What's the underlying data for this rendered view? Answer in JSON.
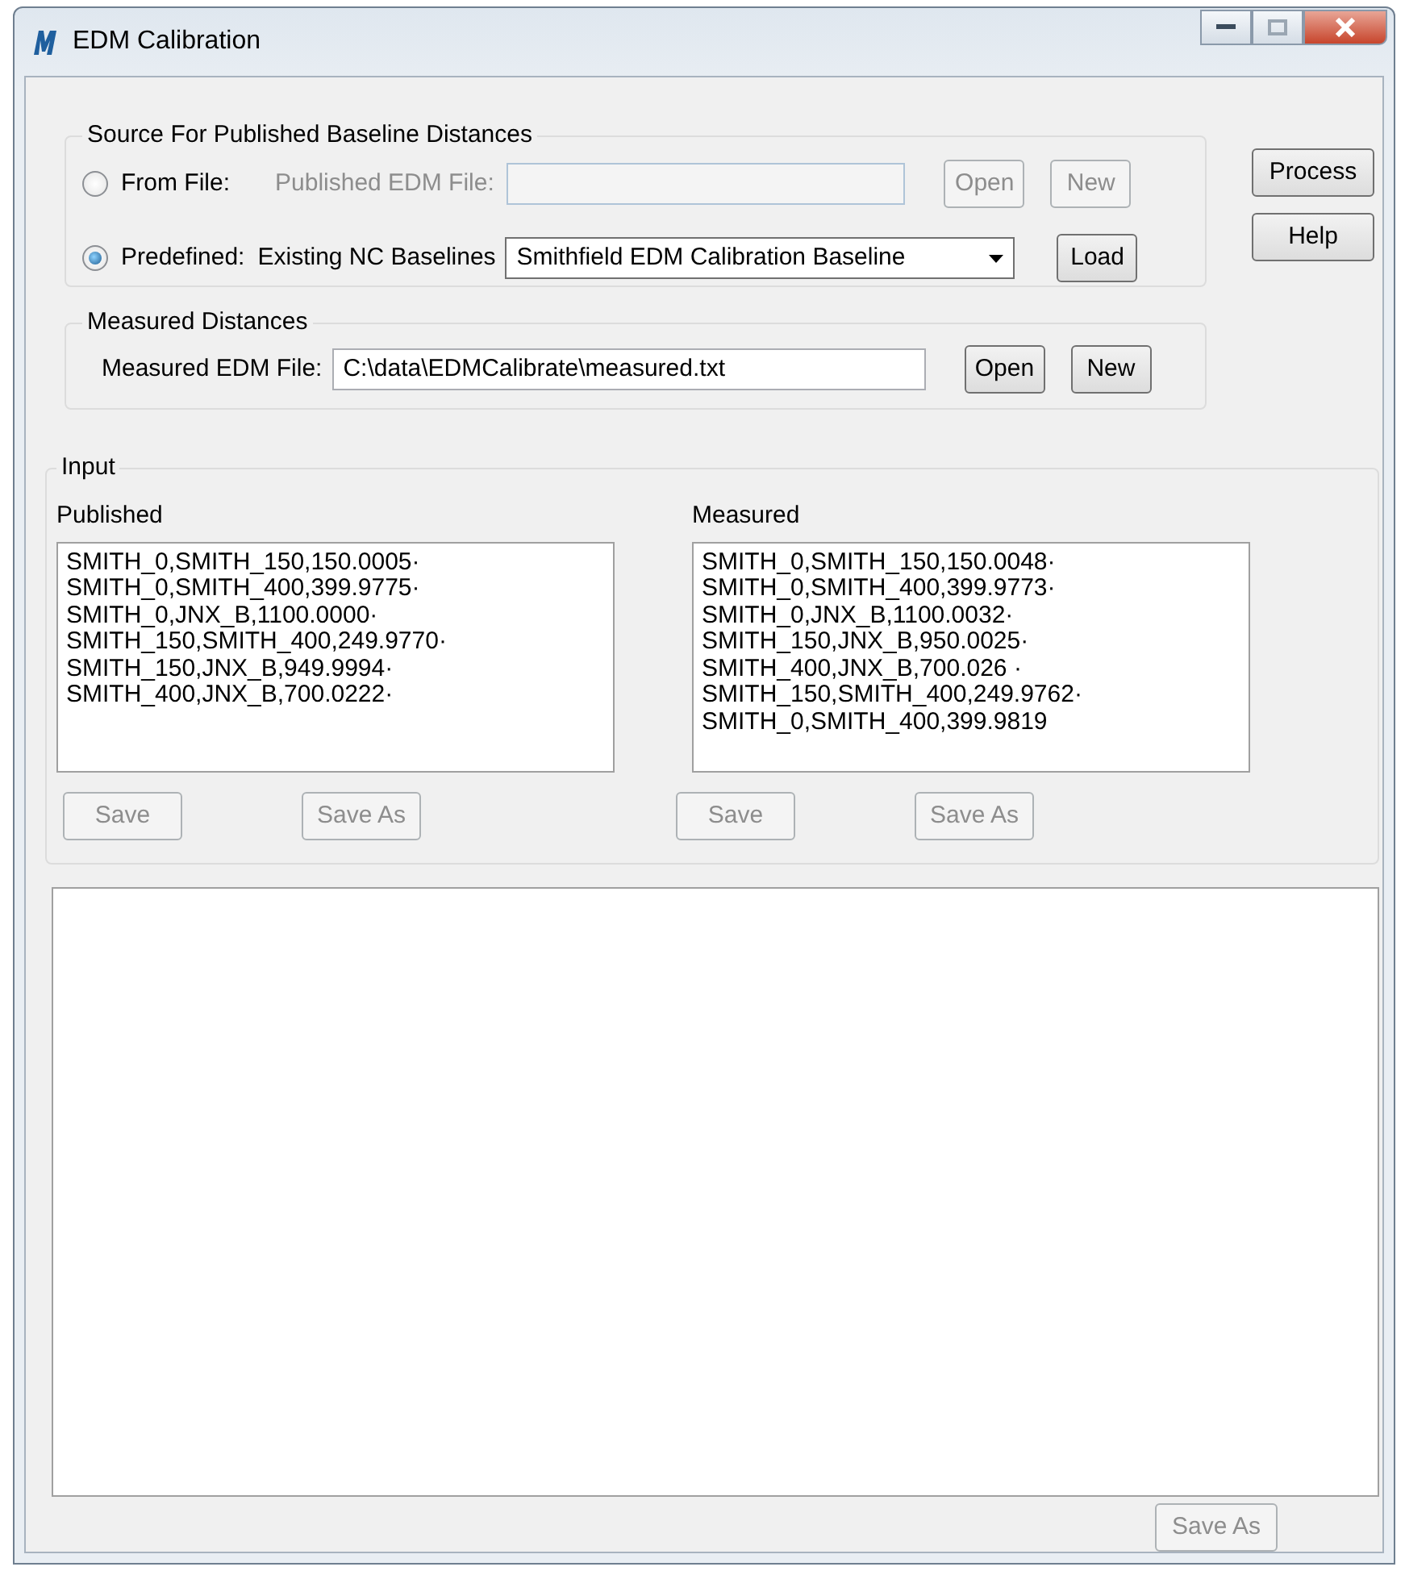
{
  "window": {
    "title": "EDM Calibration"
  },
  "source": {
    "legend": "Source For Published Baseline Distances",
    "from_file": {
      "label": "From File:",
      "selected": false,
      "field_label": "Published EDM File:",
      "disabled": true,
      "buttons": [
        {
          "label": "Open",
          "disabled": true
        },
        {
          "label": "New",
          "disabled": true
        }
      ]
    },
    "predefined": {
      "label": "Predefined:",
      "selected": true,
      "field_label": "Existing NC Baselines",
      "value": "Smithfield EDM Calibration Baseline",
      "buttons": [
        {
          "label": "Load",
          "disabled": false
        }
      ]
    }
  },
  "side_buttons": [
    {
      "label": "Process",
      "disabled": false
    },
    {
      "label": "Help",
      "disabled": false
    }
  ],
  "measured": {
    "legend": "Measured Distances",
    "field_label": "Measured EDM File:",
    "value": "C:\\data\\EDMCalibrate\\measured.txt",
    "buttons": [
      {
        "label": "Open",
        "disabled": false
      },
      {
        "label": "New",
        "disabled": false
      }
    ]
  },
  "input": {
    "legend": "Input",
    "lists": [
      {
        "label": "Published",
        "lines": [
          "SMITH_0,SMITH_150,150.0005·",
          "SMITH_0,SMITH_400,399.9775·",
          "SMITH_0,JNX_B,1100.0000·",
          "SMITH_150,SMITH_400,249.9770·",
          "SMITH_150,JNX_B,949.9994·",
          "SMITH_400,JNX_B,700.0222·"
        ],
        "buttons": [
          {
            "label": "Save",
            "disabled": true
          },
          {
            "label": "Save As",
            "disabled": true
          }
        ]
      },
      {
        "label": "Measured",
        "lines": [
          "SMITH_0,SMITH_150,150.0048·",
          "SMITH_0,SMITH_400,399.9773·",
          "SMITH_0,JNX_B,1100.0032·",
          "SMITH_150,JNX_B,950.0025·",
          "SMITH_400,JNX_B,700.026 ·",
          "SMITH_150,SMITH_400,249.9762·",
          "SMITH_0,SMITH_400,399.9819"
        ],
        "buttons": [
          {
            "label": "Save",
            "disabled": true
          },
          {
            "label": "Save As",
            "disabled": true
          }
        ]
      }
    ]
  },
  "output": {
    "buttons": [
      {
        "label": "Save As",
        "disabled": true
      }
    ]
  }
}
